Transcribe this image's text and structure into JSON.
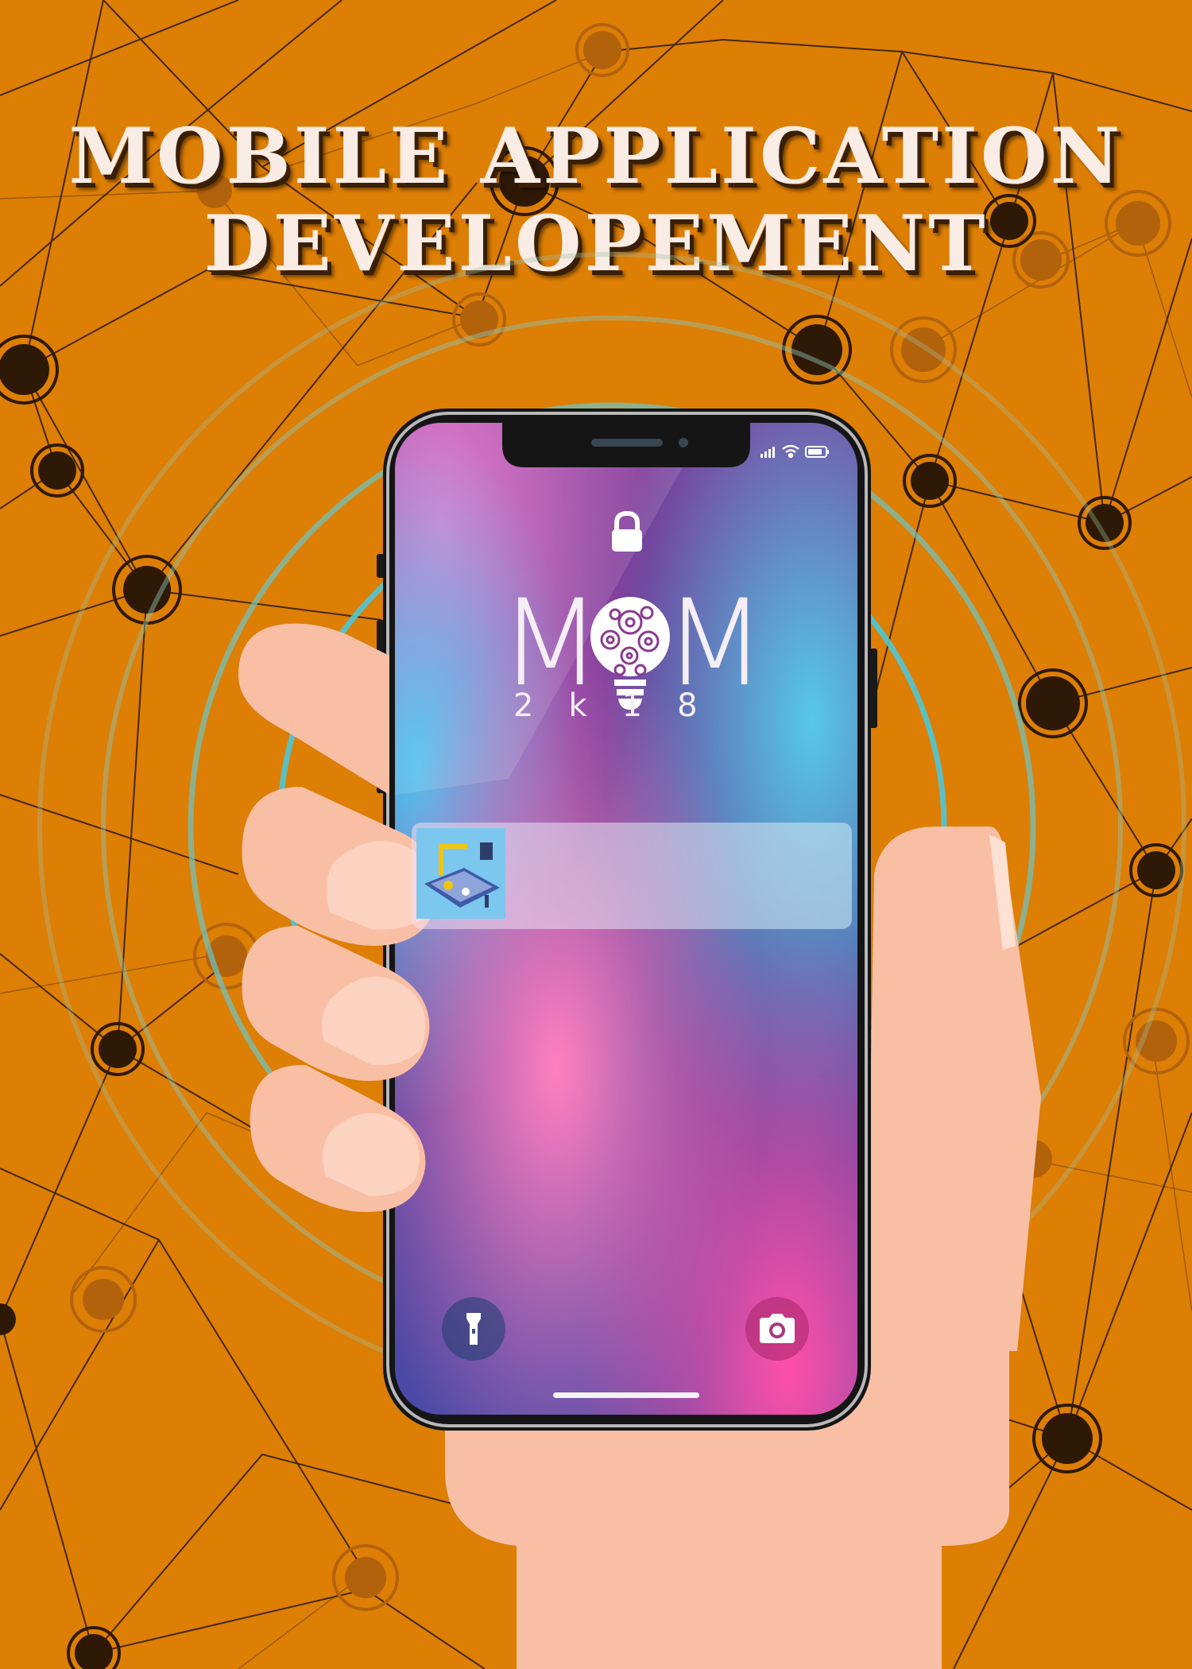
{
  "poster": {
    "title_line1": "MOBILE APPLICATION",
    "title_line2": "DEVELOPEMENT",
    "colors": {
      "background": "#dd7e05",
      "title": "#f8ece4",
      "network_node": "#2e1906",
      "hand": "#f9bfa5",
      "phone_frame": "#1c1c1c"
    }
  },
  "phone": {
    "status_icons": [
      "signal-icon",
      "wifi-icon",
      "battery-icon"
    ],
    "lock_icon": "lock-icon",
    "logo": {
      "letter_left": "M",
      "letter_right": "M",
      "subtitle": "2k18",
      "icon": "lightbulb-gears-icon"
    },
    "notification": {
      "thumbnail": "app-development-illustration"
    },
    "quick_actions": [
      "flashlight-icon",
      "camera-icon"
    ]
  }
}
